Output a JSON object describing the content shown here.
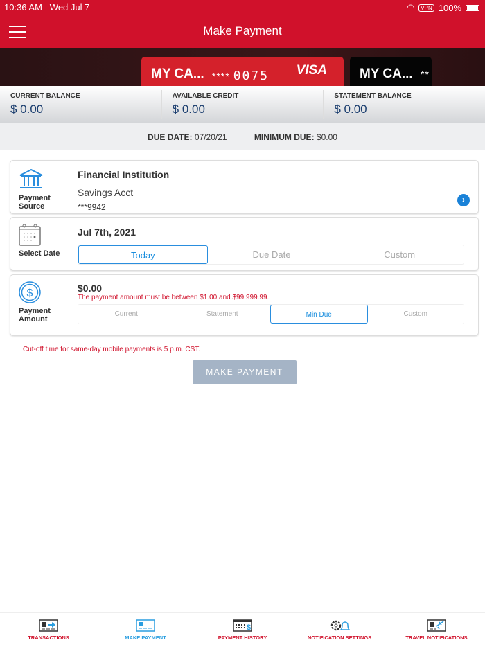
{
  "status": {
    "time": "10:36 AM",
    "date": "Wed Jul 7",
    "vpn": "VPN",
    "battery": "100%"
  },
  "nav": {
    "title": "Make Payment"
  },
  "cards": [
    {
      "name": "MY CA...",
      "mask": "****",
      "last4": "0075",
      "brand": "VISA"
    },
    {
      "name": "MY CA...",
      "mask": "**"
    }
  ],
  "balances": [
    {
      "label": "CURRENT BALANCE",
      "value": "$ 0.00"
    },
    {
      "label": "AVAILABLE CREDIT",
      "value": "$ 0.00"
    },
    {
      "label": "STATEMENT BALANCE",
      "value": "$ 0.00"
    }
  ],
  "due": {
    "due_label": "DUE DATE:",
    "due_value": "07/20/21",
    "min_label": "MINIMUM DUE:",
    "min_value": "$0.00"
  },
  "source": {
    "label1": "Payment",
    "label2": "Source",
    "institution": "Financial Institution",
    "account": "Savings Acct",
    "mask": "***9942"
  },
  "date": {
    "label": "Select Date",
    "value": "Jul 7th, 2021",
    "options": [
      "Today",
      "Due Date",
      "Custom"
    ]
  },
  "amount": {
    "label1": "Payment",
    "label2": "Amount",
    "value": "$0.00",
    "error": "The payment amount must be between $1.00 and $99,999.99.",
    "options": [
      "Current",
      "Statement",
      "Min Due",
      "Custom"
    ]
  },
  "cutoff": "Cut-off time for same-day mobile payments is 5 p.m. CST.",
  "submit": "MAKE PAYMENT",
  "tabs": [
    "TRANSACTIONS",
    "MAKE PAYMENT",
    "PAYMENT HISTORY",
    "NOTIFICATION SETTINGS",
    "TRAVEL NOTIFICATIONS"
  ],
  "colors": {
    "brand": "#d0112b",
    "accent": "#2a8ede"
  }
}
